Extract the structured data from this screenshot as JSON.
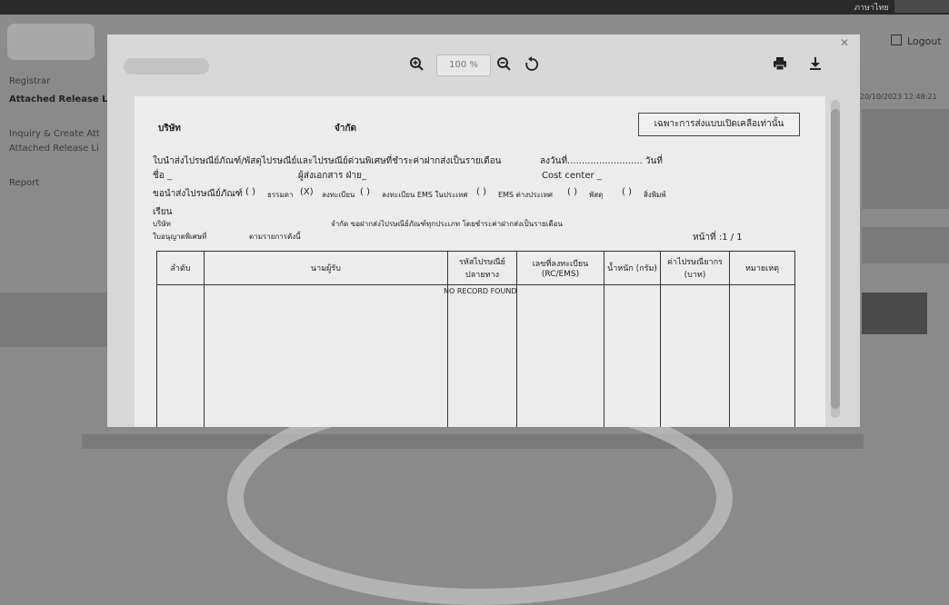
{
  "app": {
    "language_label": "ภาษาไทย",
    "logout_label": "Logout",
    "datetime": "20/10/2023 12:48:21",
    "sidebar": {
      "items": [
        {
          "label": "Registrar"
        },
        {
          "label": "Attached Release Le"
        },
        {
          "label": "Inquiry & Create Att"
        },
        {
          "label": "Attached Release Li"
        },
        {
          "label": "Report"
        }
      ]
    }
  },
  "viewer": {
    "zoom_value": "100",
    "zoom_unit": "%",
    "icons": {
      "zoom_in": "zoom-in-icon",
      "zoom_out": "zoom-out-icon",
      "rotate": "rotate-icon",
      "print": "print-icon",
      "download": "download-icon",
      "close": "close-icon"
    }
  },
  "document": {
    "company_prefix": "บริษัท",
    "company_suffix": "จำกัด",
    "badge": "เฉพาะการส่งแบบเปิดเคลือเท่านั้น",
    "line1": "ใบนำส่งไปรษณีย์ภัณฑ์/พัสดุไปรษณีย์และไปรษณีย์ด่วนพิเศษที่ชำระค่าฝากส่งเป็นรายเดือน",
    "line1_right": "ลงวันที่.......................... วันที่",
    "name_label": "ชื่อ _",
    "sender_label": "ผู้ส่งเอกสาร ฝ่าย_",
    "cost_center_label": "Cost center _",
    "mail_types_label": "ขอนำส่งไปรษณีย์ภัณฑ์",
    "opt1_mark": "( )",
    "opt1_text": "ธรรมดา",
    "opt2_mark": "(X)",
    "opt2_text": "ลงทะเบียน",
    "opt3_mark": "( )",
    "opt3_text": "ลงทะเบียน EMS ในประเทศ",
    "opt4_mark": "( )",
    "opt4_text": "EMS ต่างประเทศ",
    "opt5_mark": "( )",
    "opt5_text": "พัสดุ",
    "opt6_mark": "( )",
    "opt6_text": "สิ่งพิมพ์",
    "to_label": "เรียน",
    "company_line_left": "บริษัท",
    "company_line_right": "จำกัด ขอฝากส่งไปรษณีย์ภัณฑ์ทุกประเภท โดยชำระค่าฝากส่งเป็นรายเดือน",
    "license_label": "ใบอนุญาตพิเศษที่",
    "list_label": "ตามรายการดังนี้",
    "page_label": "หน้าที่ :1 / 1",
    "table": {
      "headers": [
        "ลำดับ",
        "นามผู้รับ",
        "รหัสไปรษณีย์ ปลายทาง",
        "เลขที่ลงทะเบียน (RC/EMS)",
        "น้ำหนัก (กรัม)",
        "ค่าไปรษณียากร (บาท)",
        "หมายเหตุ"
      ],
      "empty_message": "NO RECORD FOUND"
    }
  }
}
